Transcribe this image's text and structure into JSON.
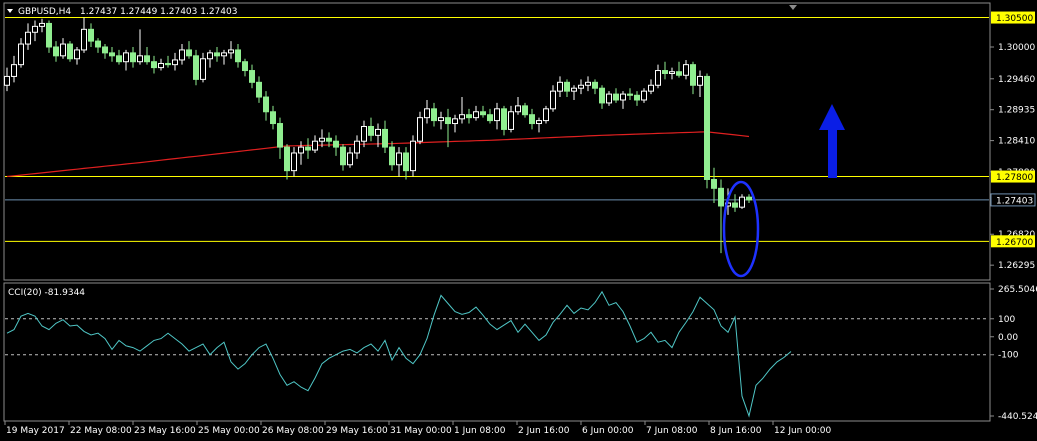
{
  "header": {
    "menu_icon": "triangle-down-icon",
    "symbol_label": "GBPUSD,H4",
    "ohlc": "1.27437 1.27449 1.27403 1.27403"
  },
  "colors": {
    "background": "#000000",
    "frame": "#8c8c8c",
    "grid": "#c0c0c0",
    "candle_up": "#ffffff",
    "candle_down": "#90ee90",
    "moving_average": "#e02020",
    "level_line": "#ffff00",
    "current_price_line": "#6e8fb0",
    "level_label_bg": "#ffff00",
    "current_price_label_bg": "#ffffff",
    "ellipse": "#1e32ff",
    "arrow": "#0a1ee6",
    "cci_line": "#4fc6c6"
  },
  "price_axis": {
    "ticks": [
      "1.30000",
      "1.29460",
      "1.28935",
      "1.28410",
      "1.27880",
      "1.26820",
      "1.26295"
    ],
    "highlighted_levels": [
      "1.30500",
      "1.27800",
      "1.26700"
    ],
    "current_price": "1.27403"
  },
  "cci_panel": {
    "label": "CCI(20) -81.9344",
    "ticks": [
      "265.5046",
      "100",
      "0.00",
      "-100",
      "-440.5247"
    ]
  },
  "time_axis": {
    "labels": [
      "19 May 2017",
      "22 May 08:00",
      "23 May 16:00",
      "25 May 00:00",
      "26 May 08:00",
      "29 May 16:00",
      "31 May 00:00",
      "1 Jun 08:00",
      "2 Jun 16:00",
      "6 Jun 00:00",
      "7 Jun 08:00",
      "8 Jun 16:00",
      "12 Jun 00:00"
    ]
  },
  "annotations": {
    "ellipse_icon": "ellipse-highlight",
    "arrow_icon": "arrow-up-icon"
  },
  "chart_data": [
    {
      "type": "candlestick",
      "title": "GBPUSD,H4",
      "ylim": [
        1.2606,
        1.3073
      ],
      "horizontal_levels": [
        1.305,
        1.278,
        1.267
      ],
      "current_price": 1.27403,
      "candles": [
        {
          "o": 1.2935,
          "h": 1.2965,
          "l": 1.2925,
          "c": 1.295
        },
        {
          "o": 1.295,
          "h": 1.2985,
          "l": 1.294,
          "c": 1.297
        },
        {
          "o": 1.297,
          "h": 1.3015,
          "l": 1.2965,
          "c": 1.3005
        },
        {
          "o": 1.3005,
          "h": 1.304,
          "l": 1.2995,
          "c": 1.3025
        },
        {
          "o": 1.3025,
          "h": 1.3045,
          "l": 1.301,
          "c": 1.3035
        },
        {
          "o": 1.3035,
          "h": 1.3048,
          "l": 1.3025,
          "c": 1.304
        },
        {
          "o": 1.304,
          "h": 1.3045,
          "l": 1.299,
          "c": 1.3
        },
        {
          "o": 1.3,
          "h": 1.301,
          "l": 1.2975,
          "c": 1.2985
        },
        {
          "o": 1.2985,
          "h": 1.3015,
          "l": 1.298,
          "c": 1.3005
        },
        {
          "o": 1.3005,
          "h": 1.301,
          "l": 1.2975,
          "c": 1.298
        },
        {
          "o": 1.298,
          "h": 1.3,
          "l": 1.297,
          "c": 1.2995
        },
        {
          "o": 1.2995,
          "h": 1.305,
          "l": 1.299,
          "c": 1.303
        },
        {
          "o": 1.303,
          "h": 1.304,
          "l": 1.3,
          "c": 1.301
        },
        {
          "o": 1.301,
          "h": 1.3015,
          "l": 1.299,
          "c": 1.3
        },
        {
          "o": 1.3,
          "h": 1.3005,
          "l": 1.298,
          "c": 1.299
        },
        {
          "o": 1.299,
          "h": 1.3,
          "l": 1.2975,
          "c": 1.2985
        },
        {
          "o": 1.2985,
          "h": 1.2995,
          "l": 1.297,
          "c": 1.2975
        },
        {
          "o": 1.2975,
          "h": 1.2995,
          "l": 1.296,
          "c": 1.299
        },
        {
          "o": 1.299,
          "h": 1.3,
          "l": 1.2965,
          "c": 1.2975
        },
        {
          "o": 1.2975,
          "h": 1.303,
          "l": 1.297,
          "c": 1.2985
        },
        {
          "o": 1.2985,
          "h": 1.3,
          "l": 1.297,
          "c": 1.2975
        },
        {
          "o": 1.2975,
          "h": 1.2985,
          "l": 1.2955,
          "c": 1.2965
        },
        {
          "o": 1.2965,
          "h": 1.298,
          "l": 1.296,
          "c": 1.2972
        },
        {
          "o": 1.2972,
          "h": 1.2985,
          "l": 1.2965,
          "c": 1.297
        },
        {
          "o": 1.297,
          "h": 1.299,
          "l": 1.296,
          "c": 1.2978
        },
        {
          "o": 1.2978,
          "h": 1.3005,
          "l": 1.297,
          "c": 1.2995
        },
        {
          "o": 1.2995,
          "h": 1.301,
          "l": 1.298,
          "c": 1.2985
        },
        {
          "o": 1.2985,
          "h": 1.2995,
          "l": 1.2935,
          "c": 1.2945
        },
        {
          "o": 1.2945,
          "h": 1.299,
          "l": 1.294,
          "c": 1.298
        },
        {
          "o": 1.298,
          "h": 1.2995,
          "l": 1.2965,
          "c": 1.299
        },
        {
          "o": 1.299,
          "h": 1.3,
          "l": 1.2975,
          "c": 1.2985
        },
        {
          "o": 1.2985,
          "h": 1.2995,
          "l": 1.297,
          "c": 1.299
        },
        {
          "o": 1.299,
          "h": 1.301,
          "l": 1.298,
          "c": 1.2995
        },
        {
          "o": 1.2995,
          "h": 1.3005,
          "l": 1.2965,
          "c": 1.2975
        },
        {
          "o": 1.2975,
          "h": 1.298,
          "l": 1.295,
          "c": 1.296
        },
        {
          "o": 1.296,
          "h": 1.297,
          "l": 1.293,
          "c": 1.294
        },
        {
          "o": 1.294,
          "h": 1.295,
          "l": 1.2905,
          "c": 1.2915
        },
        {
          "o": 1.2915,
          "h": 1.2925,
          "l": 1.2875,
          "c": 1.289
        },
        {
          "o": 1.289,
          "h": 1.29,
          "l": 1.286,
          "c": 1.287
        },
        {
          "o": 1.287,
          "h": 1.288,
          "l": 1.281,
          "c": 1.283
        },
        {
          "o": 1.283,
          "h": 1.2835,
          "l": 1.2775,
          "c": 1.279
        },
        {
          "o": 1.279,
          "h": 1.283,
          "l": 1.278,
          "c": 1.282
        },
        {
          "o": 1.282,
          "h": 1.284,
          "l": 1.28,
          "c": 1.283
        },
        {
          "o": 1.283,
          "h": 1.2845,
          "l": 1.281,
          "c": 1.2825
        },
        {
          "o": 1.2825,
          "h": 1.285,
          "l": 1.282,
          "c": 1.284
        },
        {
          "o": 1.284,
          "h": 1.286,
          "l": 1.283,
          "c": 1.2845
        },
        {
          "o": 1.2845,
          "h": 1.2855,
          "l": 1.283,
          "c": 1.284
        },
        {
          "o": 1.284,
          "h": 1.285,
          "l": 1.2815,
          "c": 1.283
        },
        {
          "o": 1.283,
          "h": 1.2835,
          "l": 1.279,
          "c": 1.28
        },
        {
          "o": 1.28,
          "h": 1.283,
          "l": 1.2795,
          "c": 1.282
        },
        {
          "o": 1.282,
          "h": 1.285,
          "l": 1.281,
          "c": 1.284
        },
        {
          "o": 1.284,
          "h": 1.2875,
          "l": 1.283,
          "c": 1.2865
        },
        {
          "o": 1.2865,
          "h": 1.288,
          "l": 1.284,
          "c": 1.285
        },
        {
          "o": 1.285,
          "h": 1.287,
          "l": 1.283,
          "c": 1.286
        },
        {
          "o": 1.286,
          "h": 1.2875,
          "l": 1.282,
          "c": 1.283
        },
        {
          "o": 1.283,
          "h": 1.284,
          "l": 1.279,
          "c": 1.28
        },
        {
          "o": 1.28,
          "h": 1.283,
          "l": 1.278,
          "c": 1.282
        },
        {
          "o": 1.282,
          "h": 1.283,
          "l": 1.2775,
          "c": 1.279
        },
        {
          "o": 1.279,
          "h": 1.285,
          "l": 1.278,
          "c": 1.284
        },
        {
          "o": 1.284,
          "h": 1.289,
          "l": 1.2835,
          "c": 1.288
        },
        {
          "o": 1.288,
          "h": 1.291,
          "l": 1.287,
          "c": 1.2895
        },
        {
          "o": 1.2895,
          "h": 1.2905,
          "l": 1.2865,
          "c": 1.2875
        },
        {
          "o": 1.2875,
          "h": 1.289,
          "l": 1.286,
          "c": 1.288
        },
        {
          "o": 1.288,
          "h": 1.2895,
          "l": 1.283,
          "c": 1.287
        },
        {
          "o": 1.287,
          "h": 1.2885,
          "l": 1.2855,
          "c": 1.2878
        },
        {
          "o": 1.2878,
          "h": 1.2915,
          "l": 1.287,
          "c": 1.2885
        },
        {
          "o": 1.2885,
          "h": 1.2895,
          "l": 1.287,
          "c": 1.288
        },
        {
          "o": 1.288,
          "h": 1.29,
          "l": 1.2875,
          "c": 1.289
        },
        {
          "o": 1.289,
          "h": 1.29,
          "l": 1.288,
          "c": 1.2885
        },
        {
          "o": 1.2885,
          "h": 1.2895,
          "l": 1.287,
          "c": 1.2875
        },
        {
          "o": 1.2875,
          "h": 1.2905,
          "l": 1.286,
          "c": 1.2895
        },
        {
          "o": 1.2895,
          "h": 1.29,
          "l": 1.285,
          "c": 1.286
        },
        {
          "o": 1.286,
          "h": 1.29,
          "l": 1.2855,
          "c": 1.289
        },
        {
          "o": 1.289,
          "h": 1.2915,
          "l": 1.2885,
          "c": 1.29
        },
        {
          "o": 1.29,
          "h": 1.2905,
          "l": 1.288,
          "c": 1.2885
        },
        {
          "o": 1.2885,
          "h": 1.2895,
          "l": 1.286,
          "c": 1.287
        },
        {
          "o": 1.287,
          "h": 1.288,
          "l": 1.2855,
          "c": 1.2875
        },
        {
          "o": 1.2875,
          "h": 1.29,
          "l": 1.287,
          "c": 1.2895
        },
        {
          "o": 1.2895,
          "h": 1.2935,
          "l": 1.289,
          "c": 1.2925
        },
        {
          "o": 1.2925,
          "h": 1.295,
          "l": 1.2915,
          "c": 1.294
        },
        {
          "o": 1.294,
          "h": 1.2945,
          "l": 1.2915,
          "c": 1.2925
        },
        {
          "o": 1.2925,
          "h": 1.2935,
          "l": 1.291,
          "c": 1.293
        },
        {
          "o": 1.293,
          "h": 1.2945,
          "l": 1.292,
          "c": 1.2935
        },
        {
          "o": 1.2935,
          "h": 1.295,
          "l": 1.2925,
          "c": 1.294
        },
        {
          "o": 1.294,
          "h": 1.2945,
          "l": 1.292,
          "c": 1.293
        },
        {
          "o": 1.293,
          "h": 1.2935,
          "l": 1.2895,
          "c": 1.2905
        },
        {
          "o": 1.2905,
          "h": 1.2925,
          "l": 1.29,
          "c": 1.292
        },
        {
          "o": 1.292,
          "h": 1.293,
          "l": 1.2905,
          "c": 1.291
        },
        {
          "o": 1.291,
          "h": 1.2925,
          "l": 1.2895,
          "c": 1.292
        },
        {
          "o": 1.292,
          "h": 1.293,
          "l": 1.291,
          "c": 1.2918
        },
        {
          "o": 1.2918,
          "h": 1.2925,
          "l": 1.29,
          "c": 1.291
        },
        {
          "o": 1.291,
          "h": 1.293,
          "l": 1.2905,
          "c": 1.2925
        },
        {
          "o": 1.2925,
          "h": 1.2945,
          "l": 1.292,
          "c": 1.2935
        },
        {
          "o": 1.2935,
          "h": 1.297,
          "l": 1.293,
          "c": 1.296
        },
        {
          "o": 1.296,
          "h": 1.2975,
          "l": 1.2945,
          "c": 1.2955
        },
        {
          "o": 1.2955,
          "h": 1.2965,
          "l": 1.2945,
          "c": 1.2958
        },
        {
          "o": 1.2958,
          "h": 1.2975,
          "l": 1.2948,
          "c": 1.2952
        },
        {
          "o": 1.2952,
          "h": 1.2978,
          "l": 1.2945,
          "c": 1.297
        },
        {
          "o": 1.297,
          "h": 1.2975,
          "l": 1.292,
          "c": 1.2935
        },
        {
          "o": 1.2935,
          "h": 1.296,
          "l": 1.2915,
          "c": 1.295
        },
        {
          "o": 1.295,
          "h": 1.2955,
          "l": 1.276,
          "c": 1.2775
        },
        {
          "o": 1.2775,
          "h": 1.2795,
          "l": 1.2735,
          "c": 1.276
        },
        {
          "o": 1.276,
          "h": 1.2775,
          "l": 1.265,
          "c": 1.273
        },
        {
          "o": 1.273,
          "h": 1.276,
          "l": 1.2715,
          "c": 1.2735
        },
        {
          "o": 1.2735,
          "h": 1.275,
          "l": 1.272,
          "c": 1.2728
        },
        {
          "o": 1.2728,
          "h": 1.275,
          "l": 1.2725,
          "c": 1.2745
        },
        {
          "o": 1.2745,
          "h": 1.275,
          "l": 1.2735,
          "c": 1.27403
        }
      ],
      "moving_average": [
        {
          "i": 0,
          "v": 1.278
        },
        {
          "i": 20,
          "v": 1.2805
        },
        {
          "i": 40,
          "v": 1.2832
        },
        {
          "i": 55,
          "v": 1.2836
        },
        {
          "i": 70,
          "v": 1.2842
        },
        {
          "i": 85,
          "v": 1.285
        },
        {
          "i": 100,
          "v": 1.2856
        },
        {
          "i": 106,
          "v": 1.2848
        }
      ]
    },
    {
      "type": "line",
      "title": "CCI(20) -81.9344",
      "ylim": [
        -440.5247,
        265.5046
      ],
      "levels": [
        100,
        -100
      ],
      "series": [
        {
          "values": [
            20,
            40,
            115,
            130,
            115,
            60,
            40,
            75,
            95,
            60,
            65,
            30,
            10,
            20,
            -10,
            -70,
            -20,
            -50,
            -60,
            -80,
            -50,
            -20,
            -10,
            20,
            -10,
            -40,
            -80,
            -60,
            -40,
            -100,
            -60,
            -30,
            -140,
            -180,
            -150,
            -100,
            -60,
            -40,
            -120,
            -210,
            -270,
            -250,
            -280,
            -300,
            -230,
            -150,
            -120,
            -100,
            -80,
            -70,
            -90,
            -60,
            -40,
            -80,
            -20,
            -130,
            -60,
            -120,
            -150,
            -100,
            -10,
            120,
            230,
            185,
            140,
            125,
            135,
            165,
            120,
            70,
            40,
            65,
            90,
            25,
            70,
            25,
            -20,
            10,
            80,
            125,
            175,
            130,
            160,
            150,
            190,
            250,
            175,
            190,
            140,
            60,
            -30,
            -10,
            25,
            -30,
            -20,
            -60,
            25,
            80,
            140,
            220,
            185,
            150,
            60,
            25,
            110,
            -330,
            -440,
            -270,
            -230,
            -180,
            -140,
            -115,
            -82
          ]
        }
      ]
    }
  ]
}
